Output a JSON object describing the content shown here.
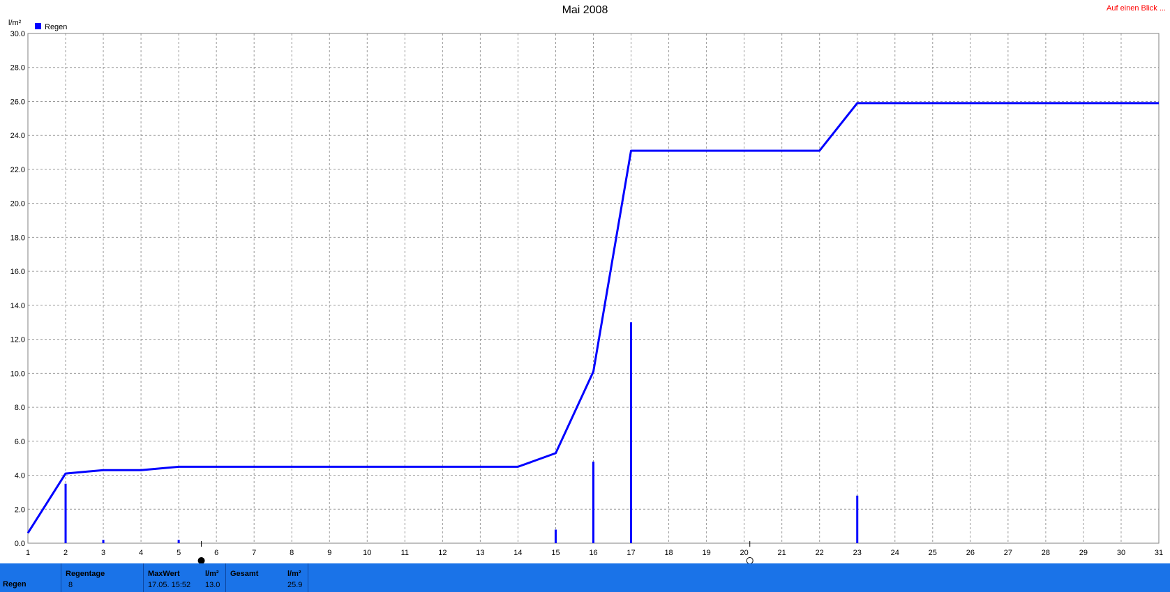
{
  "header": {
    "title": "Mai 2008",
    "link": "Auf einen Blick ..."
  },
  "chart_data": {
    "type": "line",
    "title": "Mai 2008",
    "ylabel": "l/m²",
    "xlabel": "",
    "legend": {
      "label": "Regen",
      "color": "#0000ff",
      "placement": "top-left"
    },
    "xlim": [
      1,
      31
    ],
    "ylim": [
      0,
      30
    ],
    "grid": true,
    "x_ticks": [
      "1",
      "2",
      "3",
      "4",
      "5",
      "6",
      "7",
      "8",
      "9",
      "10",
      "11",
      "12",
      "13",
      "14",
      "15",
      "16",
      "17",
      "18",
      "19",
      "20",
      "21",
      "22",
      "23",
      "24",
      "25",
      "26",
      "27",
      "28",
      "29",
      "30",
      "31"
    ],
    "y_ticks": [
      "0.0",
      "2.0",
      "4.0",
      "6.0",
      "8.0",
      "10.0",
      "12.0",
      "14.0",
      "16.0",
      "18.0",
      "20.0",
      "22.0",
      "24.0",
      "26.0",
      "28.0",
      "30.0"
    ],
    "series": [
      {
        "name": "Regen",
        "kind": "cumulative-line",
        "color": "#0000ff",
        "points": [
          [
            1,
            0.6
          ],
          [
            2,
            4.1
          ],
          [
            3,
            4.3
          ],
          [
            4,
            4.3
          ],
          [
            5,
            4.5
          ],
          [
            6,
            4.5
          ],
          [
            14,
            4.5
          ],
          [
            15,
            5.3
          ],
          [
            16,
            10.1
          ],
          [
            17,
            23.1
          ],
          [
            22,
            23.1
          ],
          [
            23,
            25.9
          ],
          [
            31,
            25.9
          ]
        ]
      },
      {
        "name": "Regen",
        "kind": "daily-bars",
        "color": "#0000ff",
        "points": [
          [
            2,
            3.5
          ],
          [
            3,
            0.2
          ],
          [
            5,
            0.2
          ],
          [
            15,
            0.8
          ],
          [
            16,
            4.8
          ],
          [
            17,
            13.0
          ],
          [
            23,
            2.8
          ]
        ]
      }
    ],
    "moon_markers": [
      {
        "x": 5.6,
        "icon": "new-moon-icon"
      },
      {
        "x": 20.15,
        "icon": "full-moon-icon"
      }
    ]
  },
  "stats": {
    "row_label": "Regen",
    "regentage_label": "Regentage",
    "regentage_value": "8",
    "maxwert_label": "MaxWert",
    "maxwert_unit": "l/m²",
    "maxwert_date": "17.05.  15:52",
    "maxwert_value": "13.0",
    "gesamt_label": "Gesamt",
    "gesamt_unit": "l/m²",
    "gesamt_value": "25.9"
  }
}
